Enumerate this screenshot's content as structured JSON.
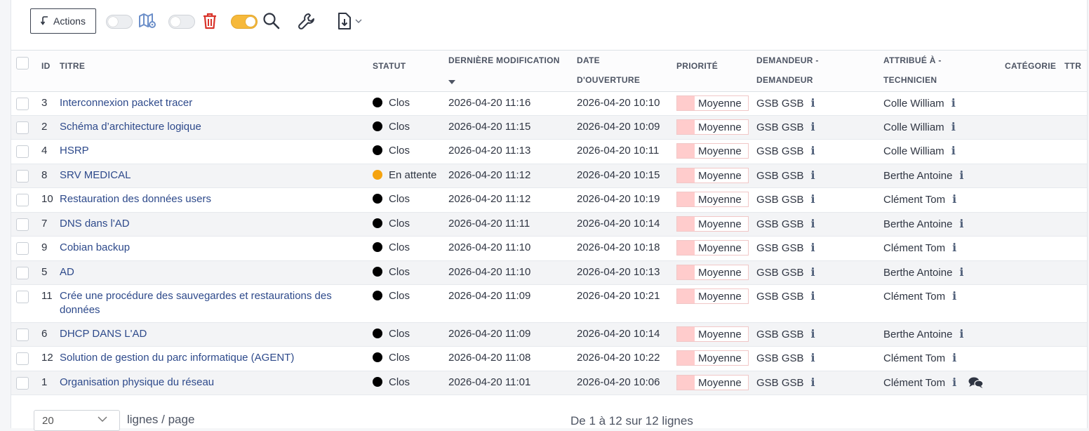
{
  "toolbar": {
    "actions_label": "Actions",
    "icons": [
      "map-icon",
      "trash-icon",
      "search-icon",
      "wrench-icon",
      "export-icon"
    ],
    "accent_toggle_color": "#f6b93b",
    "trash_color": "#d9342b"
  },
  "columns": {
    "id": "ID",
    "titre": "TITRE",
    "statut": "STATUT",
    "derniere_1": "DERNIÈRE MODIFICATION",
    "date_1": "DATE",
    "date_2": "D'OUVERTURE",
    "priorite": "PRIORITÉ",
    "demandeur_1": "DEMANDEUR -",
    "demandeur_2": "DEMANDEUR",
    "attribue_1": "ATTRIBUÉ À -",
    "attribue_2": "TECHNICIEN",
    "categorie": "CATÉGORIE",
    "ttr": "TTR"
  },
  "rows": [
    {
      "id": "3",
      "title": "Interconnexion packet tracer",
      "status": "Clos",
      "status_color": "#000000",
      "modified": "2026-04-20 11:16",
      "opened": "2026-04-20 10:10",
      "priority": "Moyenne",
      "requester": "GSB GSB",
      "tech": "Colle William"
    },
    {
      "id": "2",
      "title": "Schéma d’architecture logique",
      "status": "Clos",
      "status_color": "#000000",
      "modified": "2026-04-20 11:15",
      "opened": "2026-04-20 10:09",
      "priority": "Moyenne",
      "requester": "GSB GSB",
      "tech": "Colle William"
    },
    {
      "id": "4",
      "title": "HSRP",
      "status": "Clos",
      "status_color": "#000000",
      "modified": "2026-04-20 11:13",
      "opened": "2026-04-20 10:11",
      "priority": "Moyenne",
      "requester": "GSB GSB",
      "tech": "Colle William"
    },
    {
      "id": "8",
      "title": "SRV MEDICAL",
      "status": "En attente",
      "status_color": "#f5a30f",
      "modified": "2026-04-20 11:12",
      "opened": "2026-04-20 10:15",
      "priority": "Moyenne",
      "requester": "GSB GSB",
      "tech": "Berthe Antoine"
    },
    {
      "id": "10",
      "title": "Restauration des données users",
      "status": "Clos",
      "status_color": "#000000",
      "modified": "2026-04-20 11:12",
      "opened": "2026-04-20 10:19",
      "priority": "Moyenne",
      "requester": "GSB GSB",
      "tech": "Clément Tom"
    },
    {
      "id": "7",
      "title": "DNS dans l'AD",
      "status": "Clos",
      "status_color": "#000000",
      "modified": "2026-04-20 11:11",
      "opened": "2026-04-20 10:14",
      "priority": "Moyenne",
      "requester": "GSB GSB",
      "tech": "Berthe Antoine"
    },
    {
      "id": "9",
      "title": "Cobian backup",
      "status": "Clos",
      "status_color": "#000000",
      "modified": "2026-04-20 11:10",
      "opened": "2026-04-20 10:18",
      "priority": "Moyenne",
      "requester": "GSB GSB",
      "tech": "Clément Tom"
    },
    {
      "id": "5",
      "title": "AD",
      "status": "Clos",
      "status_color": "#000000",
      "modified": "2026-04-20 11:10",
      "opened": "2026-04-20 10:13",
      "priority": "Moyenne",
      "requester": "GSB GSB",
      "tech": "Berthe Antoine"
    },
    {
      "id": "11",
      "title": "Crée une procédure des sauvegardes et restaurations des données",
      "status": "Clos",
      "status_color": "#000000",
      "modified": "2026-04-20 11:09",
      "opened": "2026-04-20 10:21",
      "priority": "Moyenne",
      "requester": "GSB GSB",
      "tech": "Clément Tom"
    },
    {
      "id": "6",
      "title": "DHCP DANS L'AD",
      "status": "Clos",
      "status_color": "#000000",
      "modified": "2026-04-20 11:09",
      "opened": "2026-04-20 10:14",
      "priority": "Moyenne",
      "requester": "GSB GSB",
      "tech": "Berthe Antoine"
    },
    {
      "id": "12",
      "title": "Solution de gestion du parc informatique (AGENT)",
      "status": "Clos",
      "status_color": "#000000",
      "modified": "2026-04-20 11:08",
      "opened": "2026-04-20 10:22",
      "priority": "Moyenne",
      "requester": "GSB GSB",
      "tech": "Clément Tom"
    },
    {
      "id": "1",
      "title": "Organisation physique du réseau",
      "status": "Clos",
      "status_color": "#000000",
      "modified": "2026-04-20 11:01",
      "opened": "2026-04-20 10:06",
      "priority": "Moyenne",
      "requester": "GSB GSB",
      "tech": "Clément Tom"
    }
  ],
  "priority_color": "#ffcccc",
  "footer": {
    "page_size": "20",
    "page_size_label": "lignes / page",
    "summary": "De 1 à 12 sur 12 lignes"
  }
}
